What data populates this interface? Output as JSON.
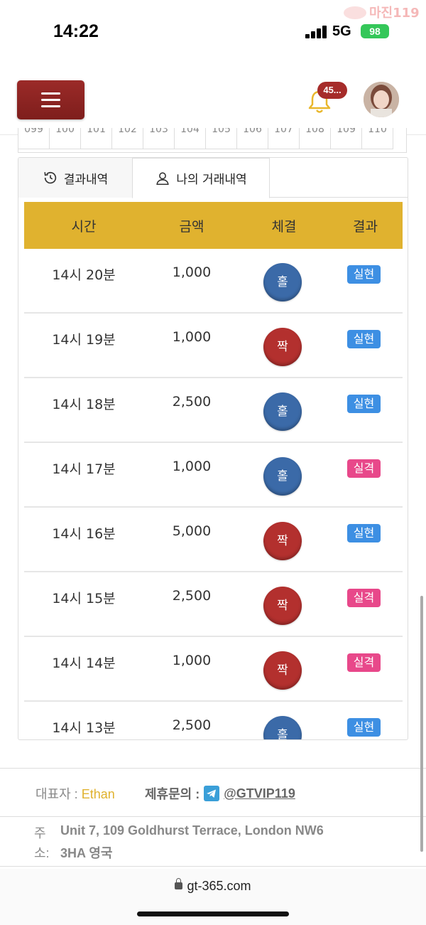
{
  "status_bar": {
    "time": "14:22",
    "network": "5G",
    "battery": "98",
    "watermark": "마진119"
  },
  "header": {
    "menu_icon": "hamburger-icon",
    "notification_icon": "bell-icon",
    "notification_count": "45...",
    "avatar_icon": "avatar"
  },
  "number_strip": [
    "099",
    "100",
    "101",
    "102",
    "103",
    "104",
    "105",
    "106",
    "107",
    "108",
    "109",
    "110"
  ],
  "tabs": [
    {
      "label": "결과내역",
      "icon": "history-icon"
    },
    {
      "label": "나의 거래내역",
      "icon": "user-icon"
    }
  ],
  "table": {
    "headers": [
      "시간",
      "금액",
      "체결",
      "결과"
    ],
    "rows": [
      {
        "time": "14시 20분",
        "amount": "1,000",
        "pick": "홀",
        "result": "실현"
      },
      {
        "time": "14시 19분",
        "amount": "1,000",
        "pick": "짝",
        "result": "실현"
      },
      {
        "time": "14시 18분",
        "amount": "2,500",
        "pick": "홀",
        "result": "실현"
      },
      {
        "time": "14시 17분",
        "amount": "1,000",
        "pick": "홀",
        "result": "실격"
      },
      {
        "time": "14시 16분",
        "amount": "5,000",
        "pick": "짝",
        "result": "실현"
      },
      {
        "time": "14시 15분",
        "amount": "2,500",
        "pick": "짝",
        "result": "실격"
      },
      {
        "time": "14시 14분",
        "amount": "1,000",
        "pick": "짝",
        "result": "실격"
      },
      {
        "time": "14시 13분",
        "amount": "2,500",
        "pick": "홀",
        "result": "실현"
      }
    ]
  },
  "colors": {
    "header_yellow": "#e0b22f",
    "odd_blue": "#3b6aa8",
    "even_red": "#b3302e",
    "result_success": "#3d8fe3",
    "result_fail": "#e8488a",
    "menu_red": "#8c2422"
  },
  "footer": {
    "rep_label": "대표자 : ",
    "rep_name": "Ethan",
    "contact_label": "제휴문의 :",
    "contact_handle": "@GTVIP119",
    "address_label_1": "주",
    "address_label_2": "소:",
    "address_line_1": "Unit 7, 109 Goldhurst Terrace, London NW6",
    "address_line_2": "3HA 영국"
  },
  "browser": {
    "url": "gt-365.com"
  }
}
